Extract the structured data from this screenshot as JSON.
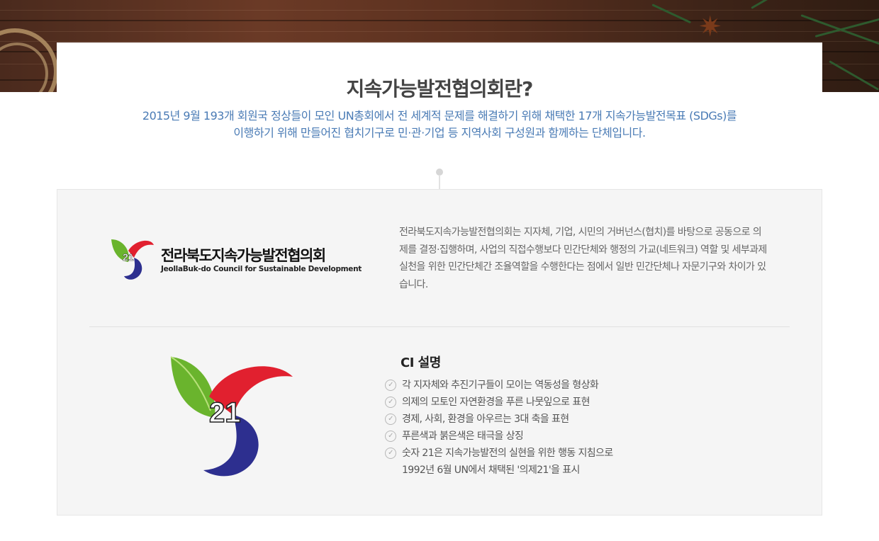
{
  "intro": {
    "title": "지속가능발전협의회란?",
    "line1": "2015년 9월 193개 회원국 정상들이 모인 UN총회에서 전 세계적 문제를 해결하기 위해 채택한 17개 지속가능발전목표 (SDGs)를",
    "line2": "이행하기 위해 만들어진 협치기구로 민·관·기업 등 지역사회 구성원과 함께하는 단체입니다."
  },
  "org_logo": {
    "name_ko": "전라북도지속가능발전협의회",
    "name_en": "JeollaBuk-do Council for Sustainable Development",
    "emblem_number": "21"
  },
  "description": "전라북도지속가능발전협의회는 지자체, 기업, 시민의 거버넌스(협치)를 바탕으로 공동으로 의제를 결정·집행하며, 사업의 직접수행보다 민간단체와 행정의 가교(네트워크) 역할 및 세부과제 실천을 위한 민간단체간 조율역할을 수행한다는 점에서 일반 민간단체나 자문기구와 차이가 있습니다.",
  "ci": {
    "title": "CI 설명",
    "emblem_number": "21",
    "items": [
      "각 지자체와 추진기구들이 모이는 역동성을 형상화",
      "의제의 모토인 자연환경을 푸른 나뭇잎으로 표현",
      "경제, 사회, 환경을 아우르는 3대 축을 표현",
      "푸른색과 붉은색은 태극을 상징",
      "숫자 21은 지속가능발전의 실현을 위한 행동 지침으로"
    ],
    "item5_line2": "1992년 6월 UN에서 채택된 '의제21'을 표시"
  },
  "colors": {
    "accent_blue": "#4a7bb5",
    "emblem_red": "#e1202f",
    "emblem_blue": "#2d2f8f",
    "emblem_green": "#6ab42d"
  },
  "icons": {
    "list_bullet": "check-circle-icon"
  }
}
